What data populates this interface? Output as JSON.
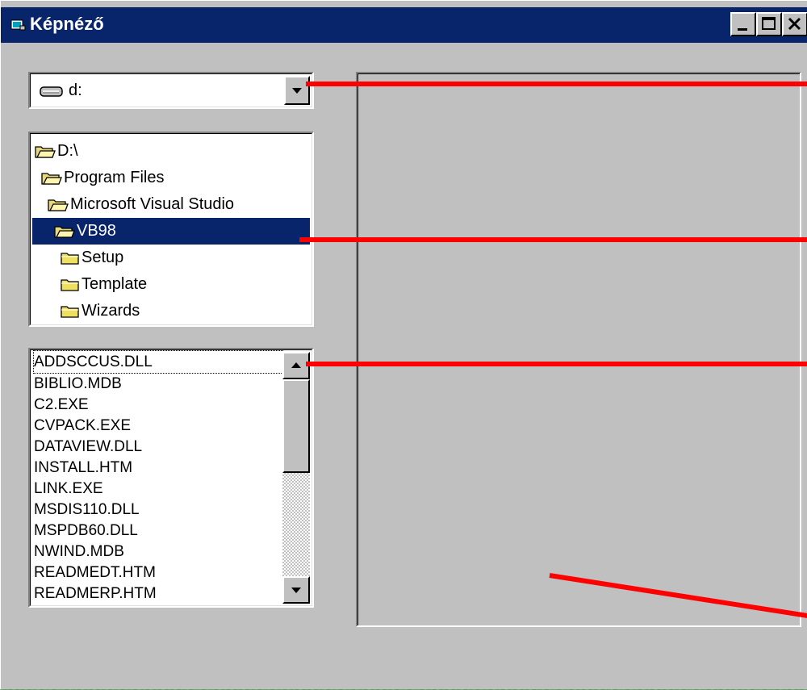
{
  "window": {
    "title": "Képnéző",
    "controls": [
      "minimize",
      "maximize",
      "close"
    ]
  },
  "drive_combo": {
    "selected": "d:",
    "icon": "drive-icon"
  },
  "directory_tree": {
    "items": [
      {
        "label": "D:\\",
        "icon": "open-folder-icon",
        "selected": false
      },
      {
        "label": "Program Files",
        "icon": "open-folder-icon",
        "selected": false
      },
      {
        "label": "Microsoft Visual Studio",
        "icon": "open-folder-icon",
        "selected": false
      },
      {
        "label": "VB98",
        "icon": "open-folder-icon",
        "selected": true
      },
      {
        "label": "Setup",
        "icon": "closed-folder-icon",
        "selected": false
      },
      {
        "label": "Template",
        "icon": "closed-folder-icon",
        "selected": false
      },
      {
        "label": "Wizards",
        "icon": "closed-folder-icon",
        "selected": false
      }
    ]
  },
  "file_list": {
    "items": [
      "ADDSCCUS.DLL",
      "BIBLIO.MDB",
      "C2.EXE",
      "CVPACK.EXE",
      "DATAVIEW.DLL",
      "INSTALL.HTM",
      "LINK.EXE",
      "MSDIS110.DLL",
      "MSPDB60.DLL",
      "NWIND.MDB",
      "READMEDT.HTM",
      "READMERP.HTM"
    ]
  },
  "colors": {
    "titlebar": "#08246b",
    "face": "#c0c0c0",
    "selection": "#08246b",
    "annotation_line": "#ff0000"
  }
}
